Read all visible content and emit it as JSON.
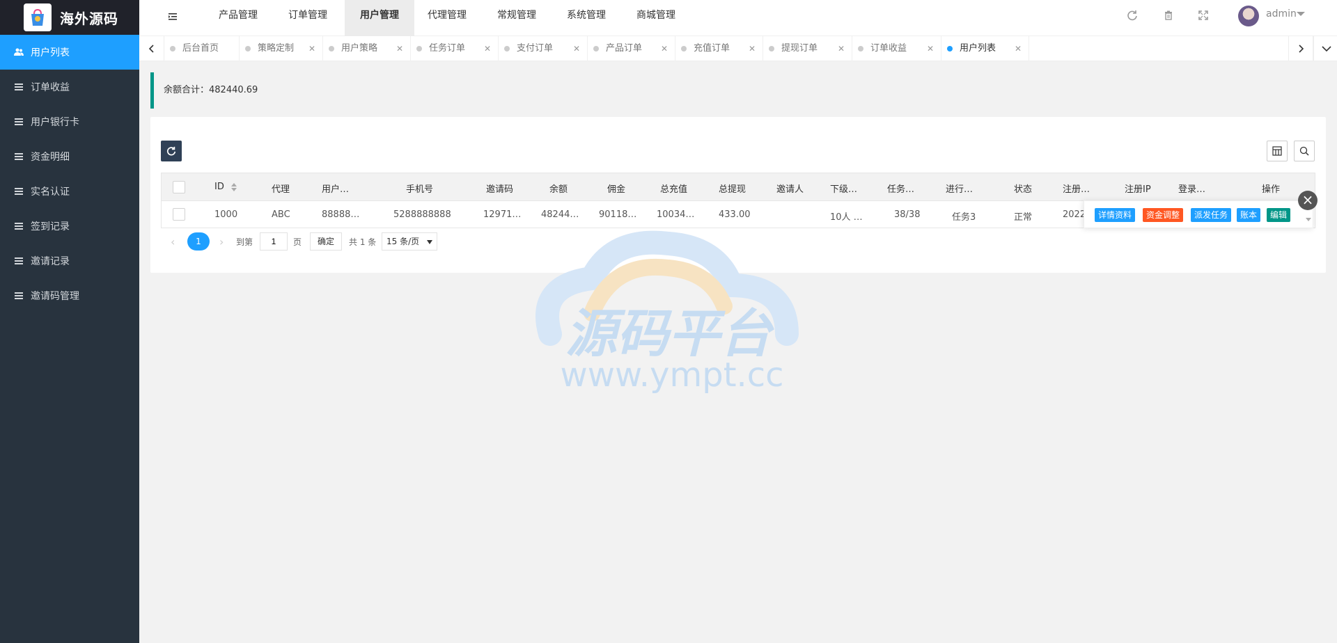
{
  "app": {
    "logo_text": "海外源码"
  },
  "header": {
    "nav": [
      "产品管理",
      "订单管理",
      "用户管理",
      "代理管理",
      "常规管理",
      "系统管理",
      "商城管理"
    ],
    "active_nav": "用户管理",
    "user_name": "admin"
  },
  "sidebar": {
    "items": [
      {
        "label": "用户列表",
        "active": true
      },
      {
        "label": "订单收益"
      },
      {
        "label": "用户银行卡"
      },
      {
        "label": "资金明细"
      },
      {
        "label": "实名认证"
      },
      {
        "label": "签到记录"
      },
      {
        "label": "邀请记录"
      },
      {
        "label": "邀请码管理"
      }
    ]
  },
  "tabs": [
    {
      "label": "后台首页"
    },
    {
      "label": "策略定制"
    },
    {
      "label": "用户策略"
    },
    {
      "label": "任务订单"
    },
    {
      "label": "支付订单"
    },
    {
      "label": "产品订单"
    },
    {
      "label": "充值订单"
    },
    {
      "label": "提现订单"
    },
    {
      "label": "订单收益"
    },
    {
      "label": "用户列表",
      "active": true
    }
  ],
  "summary": {
    "balance_label": "余额合计：482440.69"
  },
  "table": {
    "columns": [
      "ID",
      "代理",
      "用户…",
      "手机号",
      "邀请码",
      "余额",
      "佣金",
      "总充值",
      "总提现",
      "邀请人",
      "下级…",
      "任务…",
      "进行…",
      "状态",
      "注册…",
      "注册IP",
      "登录…",
      "操作"
    ],
    "rows": [
      {
        "id": "1000",
        "agent": "ABC",
        "username": "88888…",
        "phone": "5288888888",
        "invite_code": "12971…",
        "balance": "48244…",
        "commission": "90118…",
        "total_recharge": "10034…",
        "total_withdraw": "433.00",
        "inviter": "",
        "subordinates": "10人 …",
        "tasks": "38/38",
        "in_progress": "任务3",
        "status": "正常",
        "reg_time": "2022"
      }
    ],
    "row_actions": [
      {
        "label": "详情资料",
        "color": "#1e9fff"
      },
      {
        "label": "资金调整",
        "color": "#ff5722"
      },
      {
        "label": "派发任务",
        "color": "#1e9fff"
      },
      {
        "label": "账本",
        "color": "#1e9fff"
      },
      {
        "label": "编辑",
        "color": "#009688"
      }
    ]
  },
  "pagination": {
    "current": "1",
    "goto_label": "到第",
    "page_input": "1",
    "page_unit": "页",
    "confirm": "确定",
    "total": "共 1 条",
    "page_size": "15 条/页"
  },
  "watermark": {
    "title": "源码平台",
    "url": "www.ympt.cc"
  },
  "colors": {
    "sidebar_bg": "#28333e",
    "accent": "#1e9fff",
    "danger": "#ff5722",
    "success": "#009688"
  }
}
